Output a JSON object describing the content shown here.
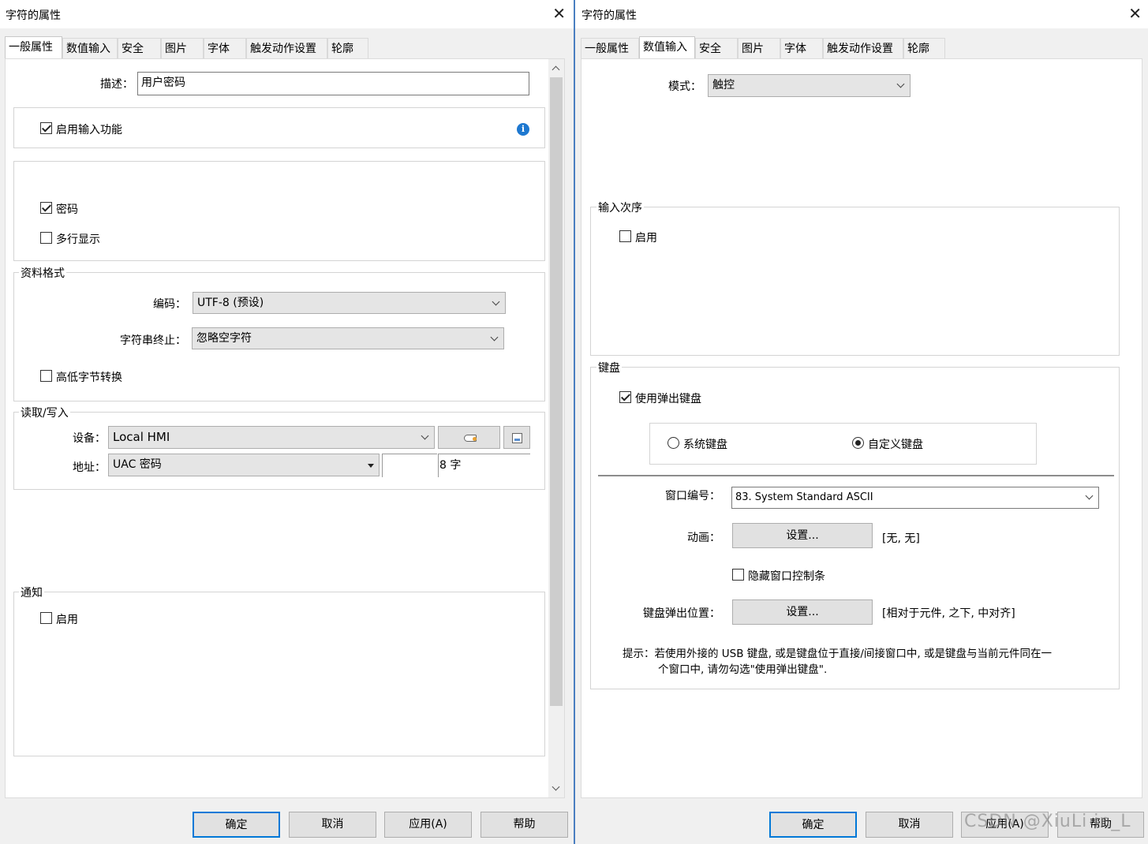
{
  "left": {
    "title": "字符的属性",
    "close": "✕",
    "tabs": [
      "一般属性",
      "数值输入",
      "安全",
      "图片",
      "字体",
      "触发动作设置",
      "轮廓"
    ],
    "description_label": "描述：",
    "description_value": "用户密码",
    "enable_input_label": "启用输入功能",
    "password_label": "密码",
    "multiline_label": "多行显示",
    "data_format": {
      "group_label": "资料格式",
      "encoding_label": "编码：",
      "encoding_value": "UTF-8 (预设)",
      "terminator_label": "字符串终止：",
      "terminator_value": "忽略空字符",
      "byte_swap_label": "高低字节转换"
    },
    "read_write": {
      "group_label": "读取/写入",
      "device_label": "设备：",
      "device_value": "Local HMI",
      "address_label": "地址：",
      "address_value": "UAC 密码",
      "length_value": "8 字"
    },
    "notify": {
      "group_label": "通知",
      "enable_label": "启用"
    },
    "footer": {
      "ok": "确定",
      "cancel": "取消",
      "apply": "应用(A)",
      "help": "帮助"
    }
  },
  "right": {
    "title": "字符的属性",
    "close": "✕",
    "tabs": [
      "一般属性",
      "数值输入",
      "安全",
      "图片",
      "字体",
      "触发动作设置",
      "轮廓"
    ],
    "mode_label": "模式：",
    "mode_value": "触控",
    "input_order": {
      "group_label": "输入次序",
      "enable_label": "启用"
    },
    "keyboard": {
      "group_label": "键盘",
      "popup_label": "使用弹出键盘",
      "system_kb_label": "系统键盘",
      "custom_kb_label": "自定义键盘",
      "window_no_label": "窗口编号：",
      "window_no_value": "83. System Standard ASCII",
      "animation_label": "动画：",
      "animation_button": "设置...",
      "animation_value": "[无, 无]",
      "hide_control_label": "隐藏窗口控制条",
      "popup_pos_label": "键盘弹出位置：",
      "popup_pos_button": "设置...",
      "popup_pos_value": "[相对于元件, 之下, 中对齐]",
      "hint_line1": "提示：若使用外接的 USB 键盘, 或是键盘位于直接/间接窗口中, 或是键盘与当前元件同在一",
      "hint_line2": "个窗口中, 请勿勾选\"使用弹出键盘\"."
    },
    "footer": {
      "ok": "确定",
      "cancel": "取消",
      "apply": "应用(A)",
      "help": "帮助"
    },
    "watermark": "CSDN @XiuLi in_L"
  },
  "colors": {
    "accent": "#0078d7",
    "divider": "#4a7fc1",
    "info": "#1e78d0"
  },
  "checkbox_states": {
    "enable_input": true,
    "password": true,
    "multiline": false,
    "byte_swap": false,
    "notify_enable": false,
    "input_order_enable": false,
    "popup_keyboard": true,
    "system_keyboard": false,
    "custom_keyboard": true,
    "hide_control": false
  }
}
